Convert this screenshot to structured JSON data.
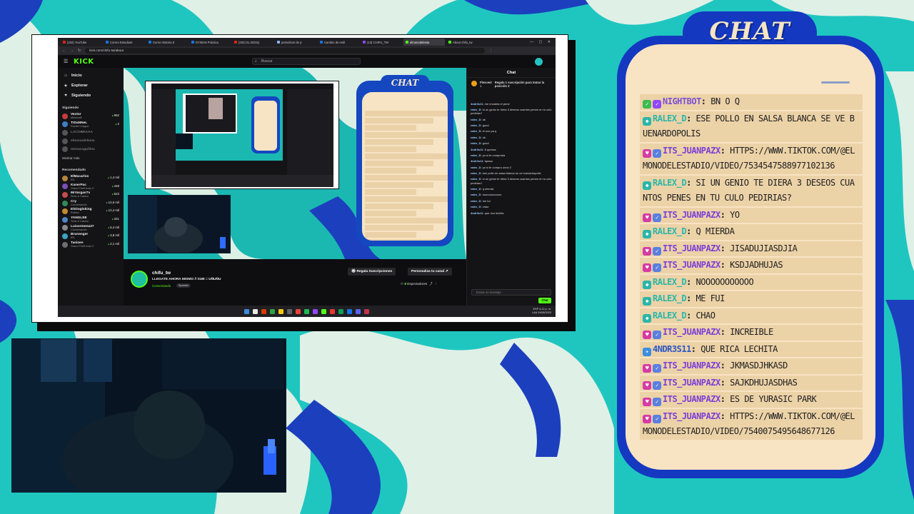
{
  "browser": {
    "tabs": [
      {
        "label": "(202) YouTube",
        "color": "#e62117",
        "active": false
      },
      {
        "label": "Correo Estudiant",
        "color": "#1a73e8",
        "active": false
      },
      {
        "label": "Curso Historia d",
        "color": "#1a73e8",
        "active": false
      },
      {
        "label": "DY08A6 Práctica",
        "color": "#1a73e8",
        "active": false
      },
      {
        "label": "(202) EL BOSQ",
        "color": "#e62117",
        "active": false
      },
      {
        "label": "periodicos de p",
        "color": "#8ab4f8",
        "active": false
      },
      {
        "label": "Cambio de estil",
        "color": "#1a73e8",
        "active": false
      },
      {
        "label": "(13) CHIFU_TW",
        "color": "#9146ff",
        "active": false
      },
      {
        "label": "elmonodelesta",
        "color": "#53fc18",
        "active": true
      },
      {
        "label": "About chifu_tw",
        "color": "#53fc18",
        "active": false
      }
    ],
    "url": "kick.com/chifu-tw/about"
  },
  "kick": {
    "logo": "KICK",
    "search_placeholder": "Buscar",
    "nav": [
      {
        "icon": "home-icon",
        "glyph": "⌂",
        "label": "Inicio"
      },
      {
        "icon": "compass-icon",
        "glyph": "✦",
        "label": "Explorar"
      },
      {
        "icon": "heart-icon",
        "glyph": "♥",
        "label": "Siguiendo"
      }
    ],
    "following_title": "Siguiendo",
    "following": [
      {
        "name": "Vector",
        "game": "Minecraft",
        "viewers": "962",
        "online": true,
        "color": "#c43d3d"
      },
      {
        "name": "TrDaNNeL",
        "game": "Rocket League",
        "viewers": "2",
        "online": true,
        "color": "#3d7fc4"
      },
      {
        "name": "LACOBRAAA",
        "game": "",
        "viewers": "",
        "online": false,
        "color": "#555"
      },
      {
        "name": "elmonodelesta",
        "game": "",
        "viewers": "",
        "online": false,
        "color": "#555"
      },
      {
        "name": "menacoguillou",
        "game": "",
        "viewers": "",
        "online": false,
        "color": "#555"
      }
    ],
    "show_more": "Mostrar más",
    "recommended_title": "Recomendado",
    "recommended": [
      {
        "name": "ElMacarlos",
        "game": "IRL",
        "viewers": "1,4 mil",
        "color": "#b5843c"
      },
      {
        "name": "KaserPac",
        "game": "Grand Theft Auto V",
        "viewers": "448",
        "color": "#7a4db8"
      },
      {
        "name": "MrVargasTv",
        "game": "Slots & Casino",
        "viewers": "523",
        "color": "#c44d4d"
      },
      {
        "name": "Cry",
        "game": "Conversando",
        "viewers": "12,5 mil",
        "color": "#2e8b57"
      },
      {
        "name": "ElGlogloking",
        "game": "Roblox",
        "viewers": "12,4 mil",
        "color": "#c48a2e"
      },
      {
        "name": "YANGLEE",
        "game": "Slots & Casino",
        "viewers": "321",
        "color": "#4d86c4"
      },
      {
        "name": "Luisormena27",
        "game": "Conversando",
        "viewers": "5,4 mil",
        "color": "#8a8a8a"
      },
      {
        "name": "Brunenger",
        "game": "IRL",
        "viewers": "3,8 mil",
        "color": "#3da3c4"
      },
      {
        "name": "Tanizen",
        "game": "Grand Theft Auto V",
        "viewers": "2,1 mil",
        "color": "#6e6e6e"
      }
    ],
    "stream": {
      "name": "chifu_tw",
      "title": "LLEGATE AHORA MISMO // SUB = UÑUÑU",
      "category": "Conversando",
      "tag": "Spanish",
      "gift_button": "Regala Suscripciones",
      "customize_button": "Personaliza tu canal",
      "viewers_count": "8",
      "viewers_label": "Espectadores"
    },
    "chat": {
      "title": "Chat",
      "pinned_user": "Flexcest",
      "pinned_count": "1",
      "pinned_text": "Regala 1 suscripción para tomar la posición 3",
      "messages": [
        {
          "user": "4ndr3s11",
          "text": "me encanta el pene"
        },
        {
          "user": "ralex_D",
          "text": "si un genio te diera 3 deseos cuantos penes en tu culo pedirias?"
        },
        {
          "user": "ralex_D",
          "text": "ok"
        },
        {
          "user": "ralex_D",
          "text": "good"
        },
        {
          "user": "ralex_D",
          "text": "el ozo pa q"
        },
        {
          "user": "ralex_D",
          "text": "ok"
        },
        {
          "user": "ralex_D",
          "text": "good"
        },
        {
          "user": "4ndr3s11",
          "text": "8 quesss"
        },
        {
          "user": "ralex_D",
          "text": "yo si te compraria"
        },
        {
          "user": "4ndr3s11",
          "text": "tqrasa"
        },
        {
          "user": "ralex_D",
          "text": "yo si te compro unos 2"
        },
        {
          "user": "ralex_D",
          "text": "ese pollo en salsa blanca se ve buenardopolis"
        },
        {
          "user": "ralex_D",
          "text": "si un genio te diera 3 deseos cuantos penes en tu culo pedirias?"
        },
        {
          "user": "ralex_D",
          "text": "q mierda"
        },
        {
          "user": "ralex_D",
          "text": "nooooooooooo"
        },
        {
          "user": "ralex_D",
          "text": "me fui"
        },
        {
          "user": "ralex_D",
          "text": "chao"
        },
        {
          "user": "4ndr3s11",
          "text": "que rica lechita"
        }
      ],
      "input_placeholder": "Enviar un mensaje",
      "send_button": "Chat"
    }
  },
  "taskbar": {
    "icons": [
      "#3a8de0",
      "#e8e8e8",
      "#d83b01",
      "#2ea043",
      "#f2c811",
      "#5f6368",
      "#ea4335",
      "#1db954",
      "#9146ff",
      "#53fc18",
      "#e33",
      "#0f9d58",
      "#1a73e8",
      "#5865f2",
      "#c4314b"
    ],
    "tray_lang": "ESP",
    "tray_region": "LAA",
    "time": "4:12 p. m.",
    "date": "24/08/2023"
  },
  "overlay_chat": {
    "title": "CHAT",
    "messages": [
      {
        "badge": "#3fb950",
        "badge_glyph": "✓",
        "badge2": "#9146ff",
        "user": "NIGHTBOT",
        "user_color": "#7b4fd6",
        "text": "BN O Q"
      },
      {
        "badge": "#2ab6a8",
        "badge_glyph": "◆",
        "badge2": "",
        "user": "RALEX_D",
        "user_color": "#2ab6a8",
        "text": "ESE POLLO EN SALSA BLANCA SE VE BUENARDOPOLIS"
      },
      {
        "badge": "#d63aa5",
        "badge_glyph": "♥",
        "badge2": "#5b7fe0",
        "user": "ITS_JUANPAZX",
        "user_color": "#7b3fd6",
        "text": "HTTPS://WWW.TIKTOK.COM/@ELMONODELESTADIO/VIDEO/7534547588977102136"
      },
      {
        "badge": "#2ab6a8",
        "badge_glyph": "◆",
        "badge2": "",
        "user": "RALEX_D",
        "user_color": "#2ab6a8",
        "text": "SI UN GENIO TE DIERA 3 DESEOS CUANTOS PENES EN TU CULO PEDIRIAS?"
      },
      {
        "badge": "#d63aa5",
        "badge_glyph": "♥",
        "badge2": "#5b7fe0",
        "user": "ITS_JUANPAZX",
        "user_color": "#7b3fd6",
        "text": "YO"
      },
      {
        "badge": "#2ab6a8",
        "badge_glyph": "◆",
        "badge2": "",
        "user": "RALEX_D",
        "user_color": "#2ab6a8",
        "text": "Q MIERDA"
      },
      {
        "badge": "#d63aa5",
        "badge_glyph": "♥",
        "badge2": "#5b7fe0",
        "user": "ITS_JUANPAZX",
        "user_color": "#7b3fd6",
        "text": "JISADUJIASDJIA"
      },
      {
        "badge": "#d63aa5",
        "badge_glyph": "♥",
        "badge2": "#5b7fe0",
        "user": "ITS_JUANPAZX",
        "user_color": "#7b3fd6",
        "text": "KSDJADHUJAS"
      },
      {
        "badge": "#2ab6a8",
        "badge_glyph": "◆",
        "badge2": "",
        "user": "RALEX_D",
        "user_color": "#2ab6a8",
        "text": "NOOOOOOOOOOO"
      },
      {
        "badge": "#2ab6a8",
        "badge_glyph": "◆",
        "badge2": "",
        "user": "RALEX_D",
        "user_color": "#2ab6a8",
        "text": "ME FUI"
      },
      {
        "badge": "#2ab6a8",
        "badge_glyph": "◆",
        "badge2": "",
        "user": "RALEX_D",
        "user_color": "#2ab6a8",
        "text": "CHAO"
      },
      {
        "badge": "#d63aa5",
        "badge_glyph": "♥",
        "badge2": "#5b7fe0",
        "user": "ITS_JUANPAZX",
        "user_color": "#7b3fd6",
        "text": "INCREIBLE"
      },
      {
        "badge": "#3a8de0",
        "badge_glyph": "✈",
        "badge2": "",
        "user": "4NDR3S11",
        "user_color": "#2a56c6",
        "text": "QUE RICA LECHITA"
      },
      {
        "badge": "#d63aa5",
        "badge_glyph": "♥",
        "badge2": "#5b7fe0",
        "user": "ITS_JUANPAZX",
        "user_color": "#7b3fd6",
        "text": "JKMASDJHKASD"
      },
      {
        "badge": "#d63aa5",
        "badge_glyph": "♥",
        "badge2": "#5b7fe0",
        "user": "ITS_JUANPAZX",
        "user_color": "#7b3fd6",
        "text": "SAJKDHUJASDHAS"
      },
      {
        "badge": "#d63aa5",
        "badge_glyph": "♥",
        "badge2": "#5b7fe0",
        "user": "ITS_JUANPAZX",
        "user_color": "#7b3fd6",
        "text": "ES DE YURASIC PARK"
      },
      {
        "badge": "#d63aa5",
        "badge_glyph": "♥",
        "badge2": "#5b7fe0",
        "user": "ITS_JUANPAZX",
        "user_color": "#7b3fd6",
        "text": "HTTPS://WWW.TIKTOK.COM/@ELMONODELESTADIO/VIDEO/7540075495648677126"
      }
    ]
  },
  "colors": {
    "teal": "#1ec8c0",
    "cream": "#f8e3c3",
    "royal_blue": "#1438c0",
    "kick_green": "#53fc18"
  }
}
